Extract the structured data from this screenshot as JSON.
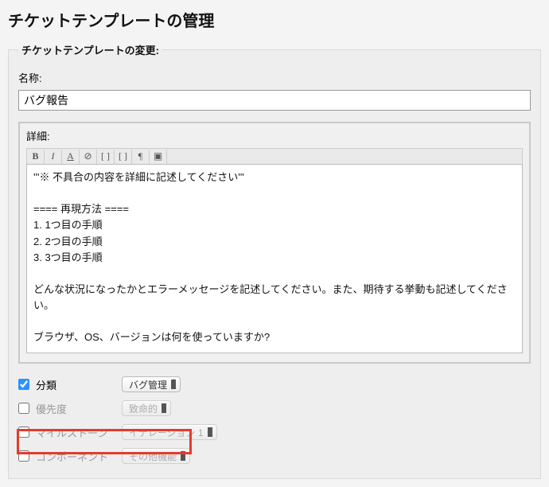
{
  "page_title": "チケットテンプレートの管理",
  "fieldset_legend": "チケットテンプレートの変更:",
  "name_label": "名称:",
  "name_value": "バグ報告",
  "details_label": "詳細:",
  "details_value": "'''※ 不具合の内容を詳細に記述してください'''\n\n==== 再現方法 ====\n1. 1つ目の手順\n2. 2つ目の手順\n3. 3つ目の手順\n\nどんな状況になったかとエラーメッセージを記述してください。また、期待する挙動も記述してください。\n\nブラウザ、OS、バージョンは何を使っていますか?\n\n追加の情報があれば提供してください。",
  "toolbar": {
    "bold": "B",
    "italic": "I",
    "underline": "A",
    "link1": "⊘",
    "link2": "[ ]",
    "link3": "[ ]",
    "pilcrow": "¶",
    "image": "▣"
  },
  "fields": {
    "type": {
      "label": "分類",
      "selected": "バグ管理",
      "checked": true
    },
    "priority": {
      "label": "優先度",
      "selected": "致命的",
      "checked": false
    },
    "milestone": {
      "label": "マイルストーン",
      "selected": "イテレーション 1",
      "checked": false
    },
    "component": {
      "label": "コンポーネント",
      "selected": "その他機能",
      "checked": false
    }
  }
}
